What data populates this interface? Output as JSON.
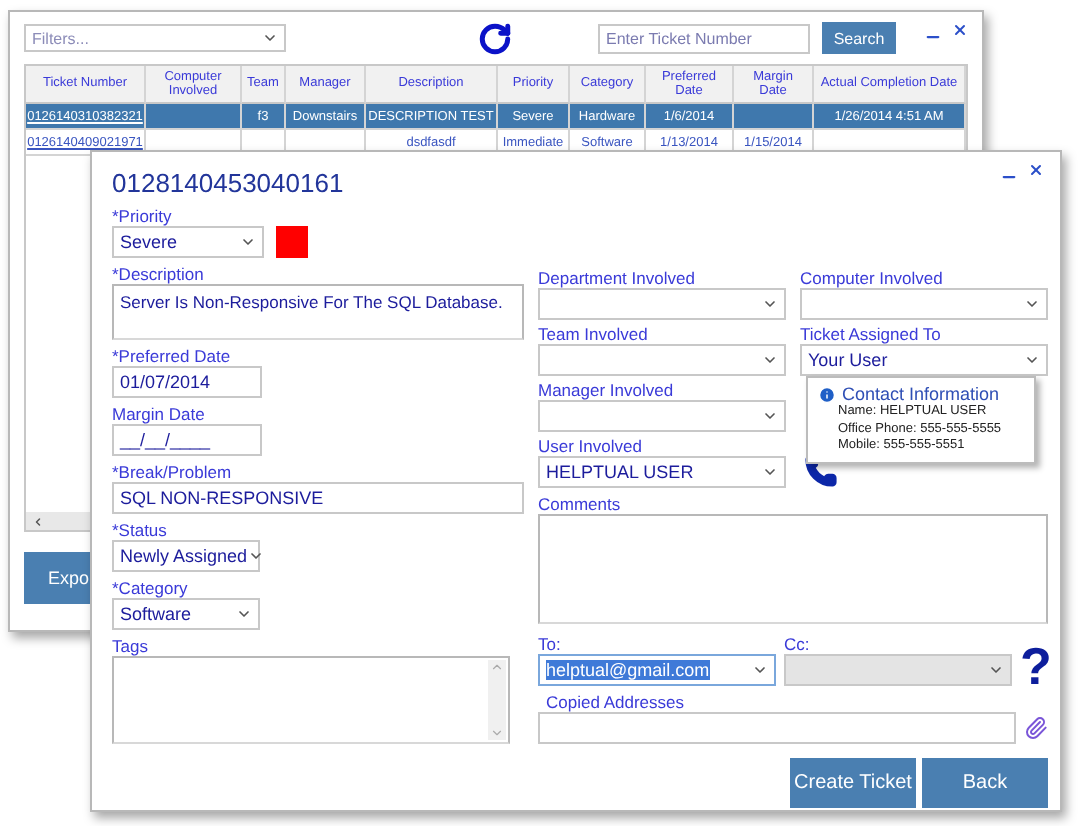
{
  "back_window": {
    "filter": {
      "placeholder": "Filters..."
    },
    "search": {
      "placeholder": "Enter Ticket Number"
    },
    "search_button": "Search",
    "table": {
      "columns": [
        "Ticket Number",
        "Computer Involved",
        "Team",
        "Manager",
        "Description",
        "Priority",
        "Category",
        "Preferred Date",
        "Margin Date",
        "Actual Completion Date"
      ],
      "rows": [
        {
          "selected": true,
          "cells": [
            "0126140310382321",
            null,
            "f3",
            "Downstairs",
            "DESCRIPTION TEST",
            "Severe",
            "Hardware",
            "1/6/2014",
            null,
            "1/26/2014 4:51 AM"
          ]
        },
        {
          "selected": false,
          "cells": [
            "0126140409021971",
            null,
            null,
            null,
            "dsdfasdf",
            "Immediate",
            "Software",
            "1/13/2014",
            "1/15/2014",
            null
          ]
        }
      ]
    },
    "export_button": "Expo"
  },
  "dialog": {
    "title": "0128140453040161",
    "left_fields": [
      {
        "kind": "select",
        "label": "*Priority",
        "value": "Severe",
        "color": "#ff0000"
      },
      {
        "kind": "textarea",
        "label": "*Description",
        "value": "Server Is Non-Responsive For The SQL Database."
      },
      {
        "kind": "date",
        "label": "*Preferred Date",
        "value": "01/07/2014"
      },
      {
        "kind": "date",
        "label": "Margin Date",
        "value": "__/__/____"
      },
      {
        "kind": "text",
        "label": "*Break/Problem",
        "value": "SQL NON-RESPONSIVE"
      },
      {
        "kind": "select",
        "label": "*Status",
        "value": "Newly Assigned"
      },
      {
        "kind": "select",
        "label": "*Category",
        "value": "Software"
      },
      {
        "kind": "list",
        "label": "Tags"
      }
    ],
    "right_fields": [
      {
        "label": "Department Involved"
      },
      {
        "label": "Computer Involved"
      },
      {
        "label": "Team Involved"
      },
      {
        "label": "Ticket Assigned To",
        "value": "Your User"
      },
      {
        "label": "Manager Involved"
      },
      {
        "label": "User Involved",
        "value": "HELPTUAL USER"
      }
    ],
    "contact_tooltip": {
      "title": "Contact Information",
      "lines": [
        "Name: HELPTUAL USER",
        "Office Phone: 555-555-5555",
        "Mobile: 555-555-5551"
      ]
    },
    "comments": {
      "label": "Comments"
    },
    "to": {
      "label": "To:",
      "value": "helptual@gmail.com",
      "highlighted": true
    },
    "cc": {
      "label": "Cc:",
      "disabled": true
    },
    "help_mark": "?",
    "copied": {
      "label": "Copied Addresses"
    },
    "buttons": [
      "Create Ticket",
      "Back"
    ]
  }
}
